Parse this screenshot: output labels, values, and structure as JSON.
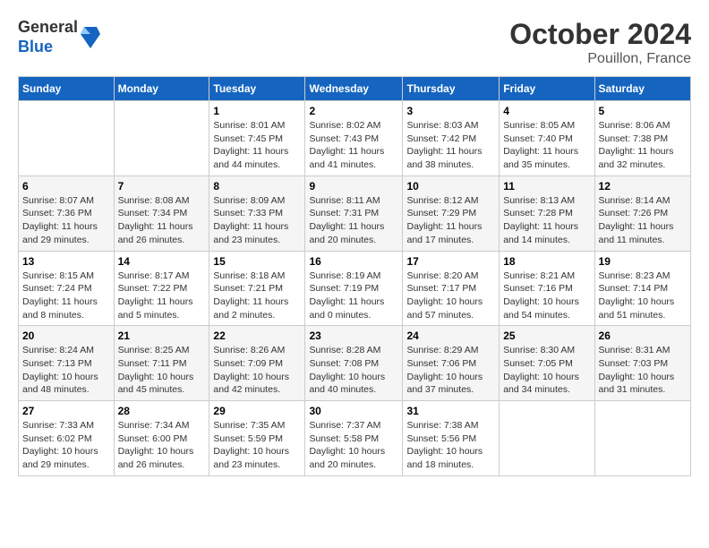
{
  "logo": {
    "general": "General",
    "blue": "Blue"
  },
  "title": {
    "month_year": "October 2024",
    "location": "Pouillon, France"
  },
  "days_of_week": [
    "Sunday",
    "Monday",
    "Tuesday",
    "Wednesday",
    "Thursday",
    "Friday",
    "Saturday"
  ],
  "weeks": [
    [
      {
        "day": "",
        "sunrise": "",
        "sunset": "",
        "daylight": ""
      },
      {
        "day": "",
        "sunrise": "",
        "sunset": "",
        "daylight": ""
      },
      {
        "day": "1",
        "sunrise": "Sunrise: 8:01 AM",
        "sunset": "Sunset: 7:45 PM",
        "daylight": "Daylight: 11 hours and 44 minutes."
      },
      {
        "day": "2",
        "sunrise": "Sunrise: 8:02 AM",
        "sunset": "Sunset: 7:43 PM",
        "daylight": "Daylight: 11 hours and 41 minutes."
      },
      {
        "day": "3",
        "sunrise": "Sunrise: 8:03 AM",
        "sunset": "Sunset: 7:42 PM",
        "daylight": "Daylight: 11 hours and 38 minutes."
      },
      {
        "day": "4",
        "sunrise": "Sunrise: 8:05 AM",
        "sunset": "Sunset: 7:40 PM",
        "daylight": "Daylight: 11 hours and 35 minutes."
      },
      {
        "day": "5",
        "sunrise": "Sunrise: 8:06 AM",
        "sunset": "Sunset: 7:38 PM",
        "daylight": "Daylight: 11 hours and 32 minutes."
      }
    ],
    [
      {
        "day": "6",
        "sunrise": "Sunrise: 8:07 AM",
        "sunset": "Sunset: 7:36 PM",
        "daylight": "Daylight: 11 hours and 29 minutes."
      },
      {
        "day": "7",
        "sunrise": "Sunrise: 8:08 AM",
        "sunset": "Sunset: 7:34 PM",
        "daylight": "Daylight: 11 hours and 26 minutes."
      },
      {
        "day": "8",
        "sunrise": "Sunrise: 8:09 AM",
        "sunset": "Sunset: 7:33 PM",
        "daylight": "Daylight: 11 hours and 23 minutes."
      },
      {
        "day": "9",
        "sunrise": "Sunrise: 8:11 AM",
        "sunset": "Sunset: 7:31 PM",
        "daylight": "Daylight: 11 hours and 20 minutes."
      },
      {
        "day": "10",
        "sunrise": "Sunrise: 8:12 AM",
        "sunset": "Sunset: 7:29 PM",
        "daylight": "Daylight: 11 hours and 17 minutes."
      },
      {
        "day": "11",
        "sunrise": "Sunrise: 8:13 AM",
        "sunset": "Sunset: 7:28 PM",
        "daylight": "Daylight: 11 hours and 14 minutes."
      },
      {
        "day": "12",
        "sunrise": "Sunrise: 8:14 AM",
        "sunset": "Sunset: 7:26 PM",
        "daylight": "Daylight: 11 hours and 11 minutes."
      }
    ],
    [
      {
        "day": "13",
        "sunrise": "Sunrise: 8:15 AM",
        "sunset": "Sunset: 7:24 PM",
        "daylight": "Daylight: 11 hours and 8 minutes."
      },
      {
        "day": "14",
        "sunrise": "Sunrise: 8:17 AM",
        "sunset": "Sunset: 7:22 PM",
        "daylight": "Daylight: 11 hours and 5 minutes."
      },
      {
        "day": "15",
        "sunrise": "Sunrise: 8:18 AM",
        "sunset": "Sunset: 7:21 PM",
        "daylight": "Daylight: 11 hours and 2 minutes."
      },
      {
        "day": "16",
        "sunrise": "Sunrise: 8:19 AM",
        "sunset": "Sunset: 7:19 PM",
        "daylight": "Daylight: 11 hours and 0 minutes."
      },
      {
        "day": "17",
        "sunrise": "Sunrise: 8:20 AM",
        "sunset": "Sunset: 7:17 PM",
        "daylight": "Daylight: 10 hours and 57 minutes."
      },
      {
        "day": "18",
        "sunrise": "Sunrise: 8:21 AM",
        "sunset": "Sunset: 7:16 PM",
        "daylight": "Daylight: 10 hours and 54 minutes."
      },
      {
        "day": "19",
        "sunrise": "Sunrise: 8:23 AM",
        "sunset": "Sunset: 7:14 PM",
        "daylight": "Daylight: 10 hours and 51 minutes."
      }
    ],
    [
      {
        "day": "20",
        "sunrise": "Sunrise: 8:24 AM",
        "sunset": "Sunset: 7:13 PM",
        "daylight": "Daylight: 10 hours and 48 minutes."
      },
      {
        "day": "21",
        "sunrise": "Sunrise: 8:25 AM",
        "sunset": "Sunset: 7:11 PM",
        "daylight": "Daylight: 10 hours and 45 minutes."
      },
      {
        "day": "22",
        "sunrise": "Sunrise: 8:26 AM",
        "sunset": "Sunset: 7:09 PM",
        "daylight": "Daylight: 10 hours and 42 minutes."
      },
      {
        "day": "23",
        "sunrise": "Sunrise: 8:28 AM",
        "sunset": "Sunset: 7:08 PM",
        "daylight": "Daylight: 10 hours and 40 minutes."
      },
      {
        "day": "24",
        "sunrise": "Sunrise: 8:29 AM",
        "sunset": "Sunset: 7:06 PM",
        "daylight": "Daylight: 10 hours and 37 minutes."
      },
      {
        "day": "25",
        "sunrise": "Sunrise: 8:30 AM",
        "sunset": "Sunset: 7:05 PM",
        "daylight": "Daylight: 10 hours and 34 minutes."
      },
      {
        "day": "26",
        "sunrise": "Sunrise: 8:31 AM",
        "sunset": "Sunset: 7:03 PM",
        "daylight": "Daylight: 10 hours and 31 minutes."
      }
    ],
    [
      {
        "day": "27",
        "sunrise": "Sunrise: 7:33 AM",
        "sunset": "Sunset: 6:02 PM",
        "daylight": "Daylight: 10 hours and 29 minutes."
      },
      {
        "day": "28",
        "sunrise": "Sunrise: 7:34 AM",
        "sunset": "Sunset: 6:00 PM",
        "daylight": "Daylight: 10 hours and 26 minutes."
      },
      {
        "day": "29",
        "sunrise": "Sunrise: 7:35 AM",
        "sunset": "Sunset: 5:59 PM",
        "daylight": "Daylight: 10 hours and 23 minutes."
      },
      {
        "day": "30",
        "sunrise": "Sunrise: 7:37 AM",
        "sunset": "Sunset: 5:58 PM",
        "daylight": "Daylight: 10 hours and 20 minutes."
      },
      {
        "day": "31",
        "sunrise": "Sunrise: 7:38 AM",
        "sunset": "Sunset: 5:56 PM",
        "daylight": "Daylight: 10 hours and 18 minutes."
      },
      {
        "day": "",
        "sunrise": "",
        "sunset": "",
        "daylight": ""
      },
      {
        "day": "",
        "sunrise": "",
        "sunset": "",
        "daylight": ""
      }
    ]
  ]
}
